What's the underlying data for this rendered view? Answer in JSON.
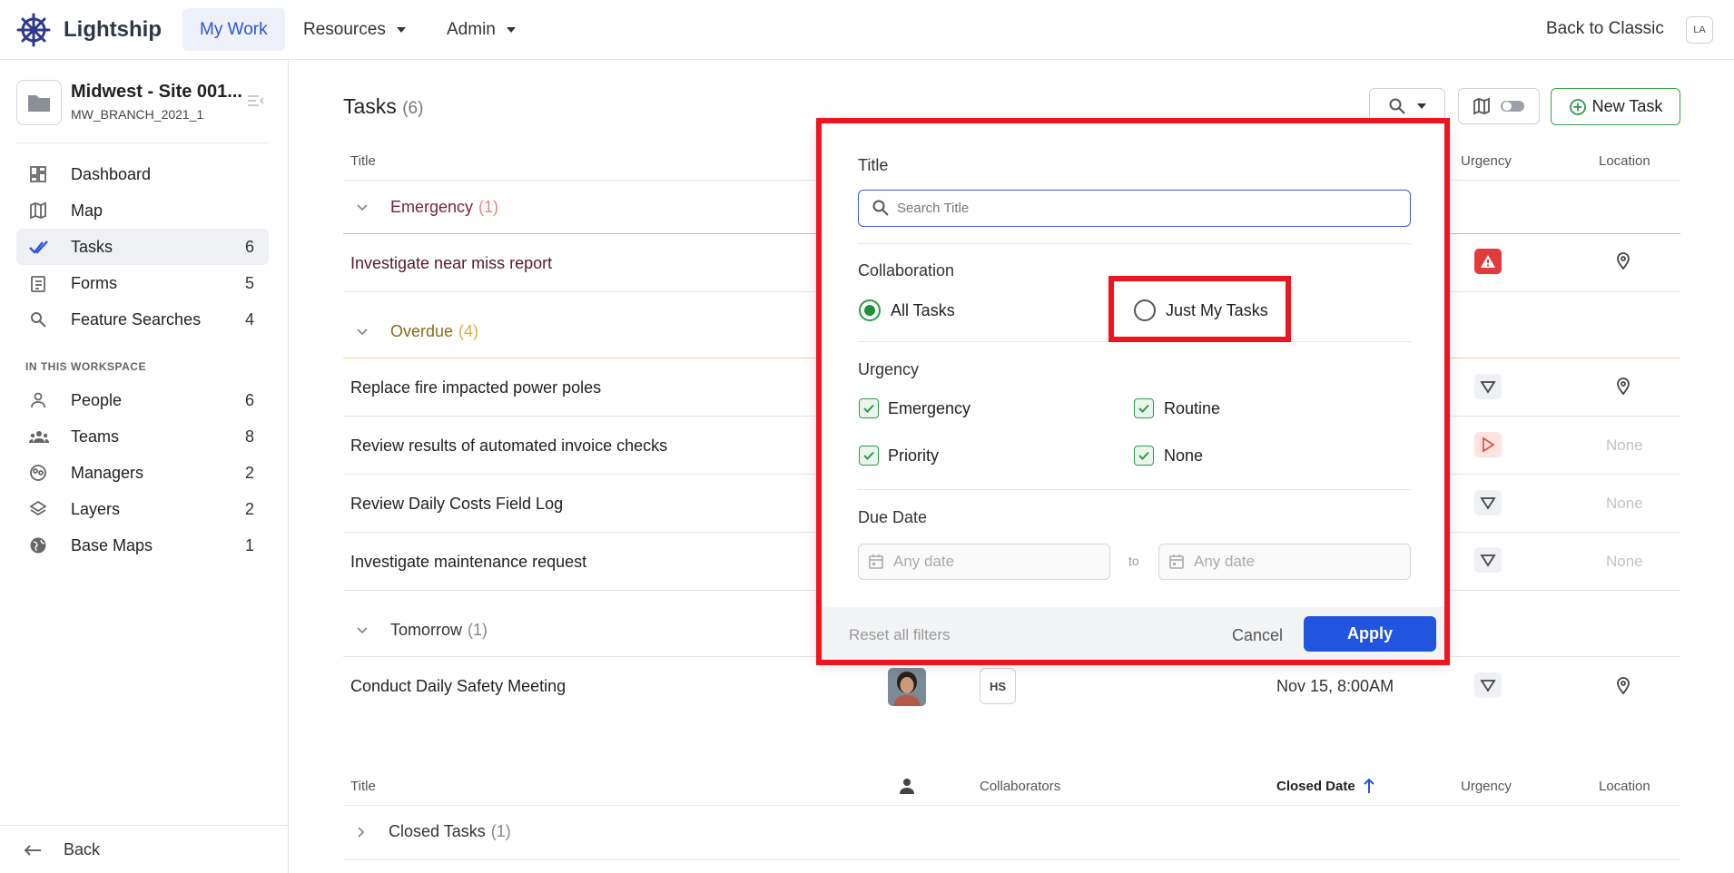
{
  "header": {
    "brand": "Lightship",
    "nav": [
      {
        "label": "My Work"
      },
      {
        "label": "Resources"
      },
      {
        "label": "Admin"
      }
    ],
    "back_to_classic": "Back to Classic",
    "user_initials": "LA"
  },
  "sidebar": {
    "workspace_title": "Midwest - Site 001...",
    "workspace_code": "MW_BRANCH_2021_1",
    "items": [
      {
        "label": "Dashboard",
        "count": "",
        "icon": "dashboard-icon"
      },
      {
        "label": "Map",
        "count": "",
        "icon": "map-icon"
      },
      {
        "label": "Tasks",
        "count": "6",
        "icon": "check-icon"
      },
      {
        "label": "Forms",
        "count": "5",
        "icon": "clipboard-icon"
      },
      {
        "label": "Feature Searches",
        "count": "4",
        "icon": "search-icon"
      }
    ],
    "section_heading": "IN THIS WORKSPACE",
    "workspace_items": [
      {
        "label": "People",
        "count": "6",
        "icon": "person-icon"
      },
      {
        "label": "Teams",
        "count": "8",
        "icon": "team-icon"
      },
      {
        "label": "Managers",
        "count": "2",
        "icon": "manager-icon"
      },
      {
        "label": "Layers",
        "count": "2",
        "icon": "layers-icon"
      },
      {
        "label": "Base Maps",
        "count": "1",
        "icon": "globe-icon"
      }
    ],
    "back": "Back"
  },
  "main": {
    "title": "Tasks",
    "count": "(6)",
    "new_task": "New Task",
    "columns": {
      "title": "Title",
      "urgency": "Urgency",
      "location": "Location"
    },
    "groups": {
      "emergency": {
        "label": "Emergency",
        "count": "(1)"
      },
      "overdue": {
        "label": "Overdue",
        "count": "(4)"
      },
      "tomorrow": {
        "label": "Tomorrow",
        "count": "(1)"
      }
    },
    "rows": [
      {
        "title": "Investigate near miss report"
      },
      {
        "title": "Replace fire impacted power poles"
      },
      {
        "title": "Review results of automated invoice checks",
        "location": "None"
      },
      {
        "title": "Review Daily Costs Field Log",
        "location": "None"
      },
      {
        "title": "Investigate maintenance request",
        "location": "None"
      },
      {
        "title": "Conduct Daily Safety Meeting",
        "collaborator": "HS",
        "due": "Nov 15, 8:00AM"
      }
    ],
    "closed": {
      "columns": {
        "title": "Title",
        "collaborators": "Collaborators",
        "closed_date": "Closed Date",
        "urgency": "Urgency",
        "location": "Location"
      },
      "group": {
        "label": "Closed Tasks",
        "count": "(1)"
      }
    }
  },
  "filter": {
    "title_label": "Title",
    "search_placeholder": "Search Title",
    "collaboration_label": "Collaboration",
    "all_tasks": "All Tasks",
    "just_my_tasks": "Just My Tasks",
    "urgency_label": "Urgency",
    "urgency_options": [
      "Emergency",
      "Routine",
      "Priority",
      "None"
    ],
    "due_date_label": "Due Date",
    "date_from": "Any date",
    "date_to": "Any date",
    "to": "to",
    "reset": "Reset all filters",
    "cancel": "Cancel",
    "apply": "Apply"
  },
  "colors": {
    "accent": "#2155e0",
    "emergency": "#7a1f3a",
    "overdue": "#8a6a1a",
    "highlight": "#f0141e",
    "green": "#2e9a46"
  }
}
